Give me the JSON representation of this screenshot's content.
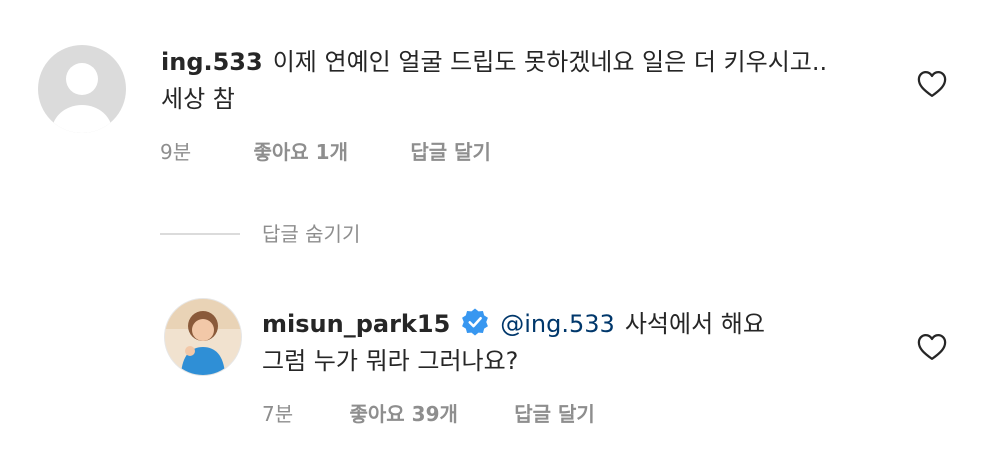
{
  "comments": [
    {
      "username": "ing.533",
      "text_line1": "이제 연예인 얼굴 드립도 못하겠네요  일은 더 키우시고..",
      "text_line2": "세상 참",
      "time": "9분",
      "likes": "좋아요 1개",
      "reply_label": "답글 달기"
    }
  ],
  "replies_toggle": {
    "label": "답글 숨기기"
  },
  "reply": {
    "username": "misun_park15",
    "verified": true,
    "mention": "@ing.533",
    "text_line1": "사석에서 해요",
    "text_line2": "그럼 누가 뭐라 그러나요?",
    "time": "7분",
    "likes": "좋아요 39개",
    "reply_label": "답글 달기"
  },
  "colors": {
    "text": "#262626",
    "secondary": "#8e8e8e",
    "mention": "#00376b",
    "verified": "#3897f0",
    "divider": "#dbdbdb"
  },
  "icons": {
    "avatar_default": "default-avatar-icon",
    "like": "heart-outline-icon",
    "verified": "verified-badge-icon"
  }
}
